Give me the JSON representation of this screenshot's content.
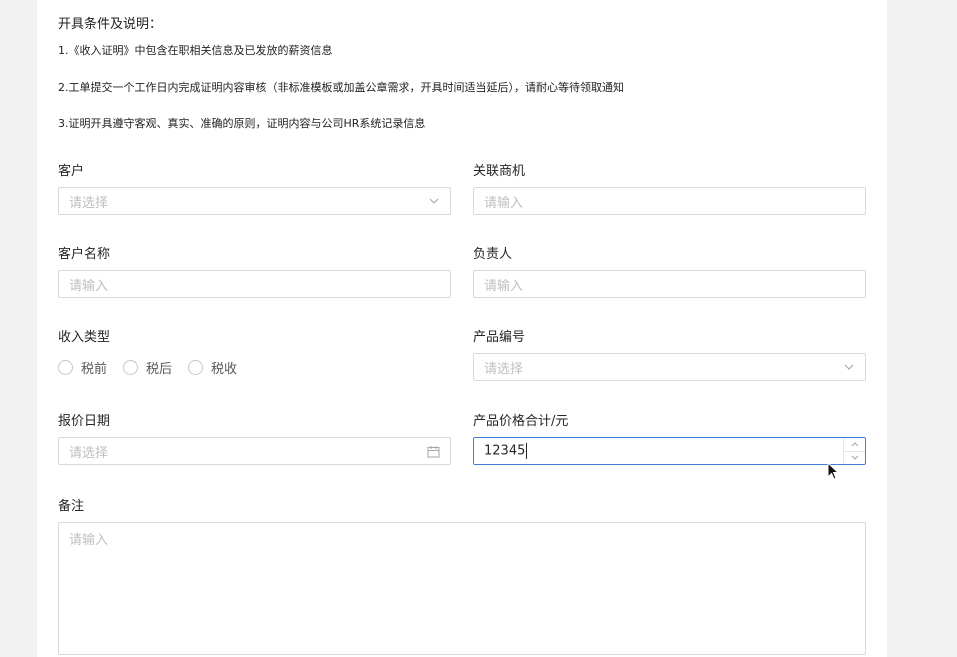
{
  "notice": {
    "title": "开具条件及说明：",
    "items": [
      "1.《收入证明》中包含在职相关信息及已发放的薪资信息",
      "2.工单提交一个工作日内完成证明内容审核（非标准模板或加盖公章需求，开具时间适当延后），请耐心等待领取通知",
      "3.证明开具遵守客观、真实、准确的原则，证明内容与公司HR系统记录信息"
    ]
  },
  "form": {
    "customer": {
      "label": "客户",
      "placeholder": "请选择"
    },
    "related_opportunity": {
      "label": "关联商机",
      "placeholder": "请输入"
    },
    "customer_name": {
      "label": "客户名称",
      "placeholder": "请输入"
    },
    "owner": {
      "label": "负责人",
      "placeholder": "请输入"
    },
    "income_type": {
      "label": "收入类型",
      "options": [
        "税前",
        "税后",
        "税收"
      ]
    },
    "product_code": {
      "label": "产品编号",
      "placeholder": "请选择"
    },
    "quote_date": {
      "label": "报价日期",
      "placeholder": "请选择"
    },
    "total_price": {
      "label": "产品价格合计/元",
      "value": "12345"
    },
    "remark": {
      "label": "备注",
      "placeholder": "请输入"
    }
  },
  "icons": {
    "dropdown": "chevron-down-icon",
    "calendar": "calendar-icon",
    "stepper_up": "chevron-up-icon",
    "stepper_down": "chevron-down-icon",
    "mouse": "mouse-pointer-icon"
  },
  "colors": {
    "background": "#f2f2f2",
    "panel": "#ffffff",
    "border": "#d9d9d9",
    "focus_border": "#3f7fd6",
    "placeholder": "#bfbfbf"
  }
}
